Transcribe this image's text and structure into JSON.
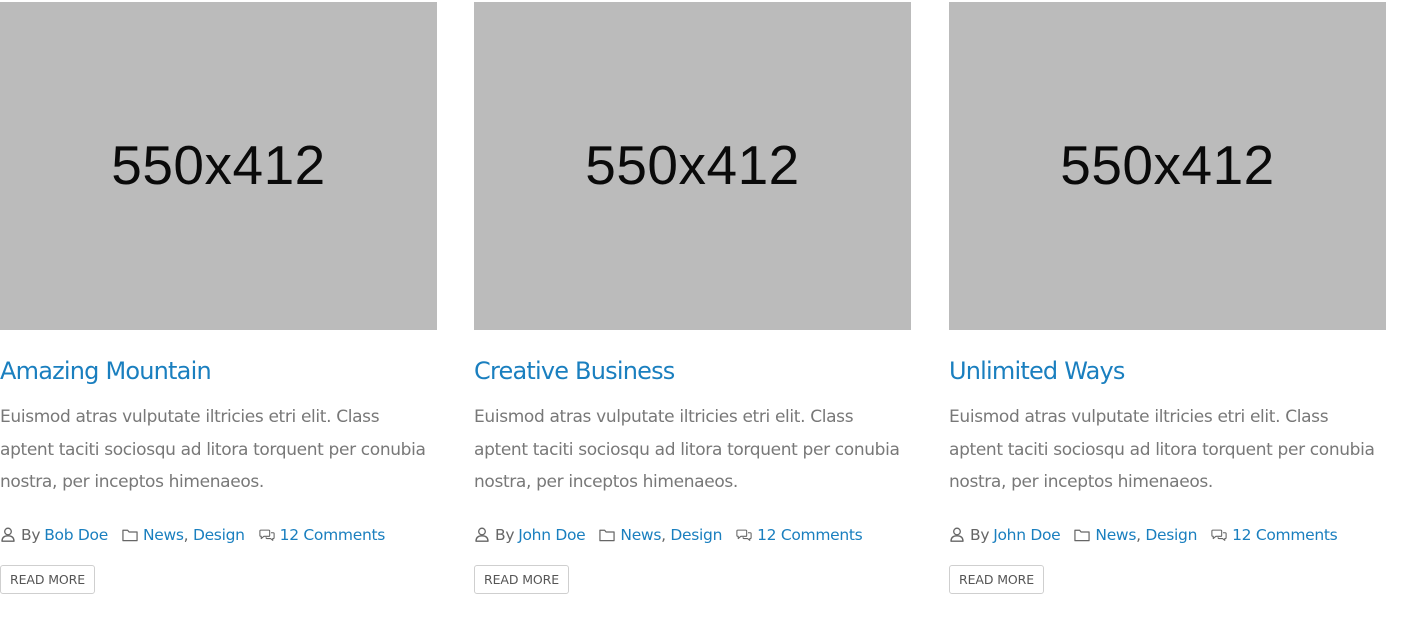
{
  "posts": [
    {
      "image_label": "550x412",
      "title": "Amazing Mountain",
      "excerpt": "Euismod atras vulputate iltricies etri elit. Class aptent taciti sociosqu ad litora torquent per conubia nostra, per inceptos himenaeos.",
      "by_label": "By",
      "author": "Bob Doe",
      "categories": [
        "News",
        "Design"
      ],
      "category_separator": ",",
      "comments": "12 Comments",
      "read_more": "READ MORE"
    },
    {
      "image_label": "550x412",
      "title": "Creative Business",
      "excerpt": "Euismod atras vulputate iltricies etri elit. Class aptent taciti sociosqu ad litora torquent per conubia nostra, per inceptos himenaeos.",
      "by_label": "By",
      "author": "John Doe",
      "categories": [
        "News",
        "Design"
      ],
      "category_separator": ",",
      "comments": "12 Comments",
      "read_more": "READ MORE"
    },
    {
      "image_label": "550x412",
      "title": "Unlimited Ways",
      "excerpt": "Euismod atras vulputate iltricies etri elit. Class aptent taciti sociosqu ad litora torquent per conubia nostra, per inceptos himenaeos.",
      "by_label": "By",
      "author": "John Doe",
      "categories": [
        "News",
        "Design"
      ],
      "category_separator": ",",
      "comments": "12 Comments",
      "read_more": "READ MORE"
    }
  ],
  "icons": {
    "author": "user-icon",
    "categories": "folder-icon",
    "comments": "comments-icon"
  },
  "colors": {
    "link": "#1a7fbf",
    "text": "#787878",
    "meta_text": "#666666",
    "placeholder_bg": "#bbbbbb",
    "button_border": "#cfcfcf"
  }
}
